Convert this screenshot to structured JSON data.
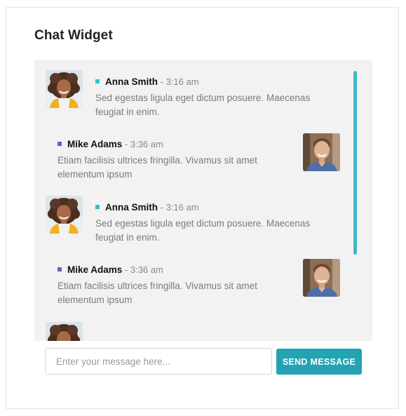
{
  "widget": {
    "title": "Chat Widget"
  },
  "colors": {
    "accent": "#23a3b3",
    "scrollbar": "#3db8c6",
    "dot_anna": "#2fc3c6",
    "dot_mike": "#5a62c4",
    "panel_bg": "#f2f2f2"
  },
  "messages": [
    {
      "name": "Anna Smith",
      "time": "- 3:16 am",
      "text": "Sed egestas ligula eget dictum posuere. Maecenas feugiat in enim.",
      "avatar": "woman-avatar"
    },
    {
      "name": "Mike Adams",
      "time": "- 3:36 am",
      "text": "Etiam facilisis ultrices fringilla. Vivamus sit amet elementum ipsum",
      "avatar": "man-avatar"
    },
    {
      "name": "Anna Smith",
      "time": "- 3:16 am",
      "text": "Sed egestas ligula eget dictum posuere. Maecenas feugiat in enim.",
      "avatar": "woman-avatar"
    },
    {
      "name": "Mike Adams",
      "time": "- 3:36 am",
      "text": "Etiam facilisis ultrices fringilla. Vivamus sit amet elementum ipsum",
      "avatar": "man-avatar"
    }
  ],
  "composer": {
    "placeholder": "Enter your message here...",
    "value": "",
    "send_label": "SEND MESSAGE"
  }
}
